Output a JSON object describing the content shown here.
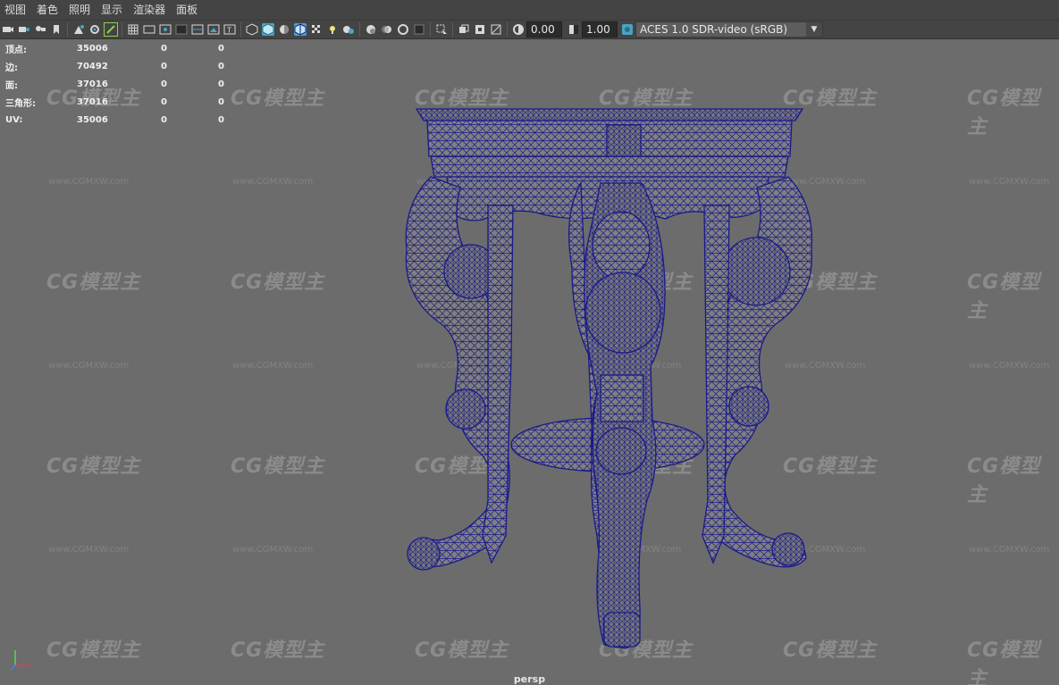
{
  "menu": {
    "items": [
      "视图",
      "着色",
      "照明",
      "显示",
      "渲染器",
      "面板"
    ]
  },
  "toolbar": {
    "exposure_value": "0.00",
    "gamma_value": "1.00",
    "color_space": "ACES 1.0 SDR-video (sRGB)"
  },
  "stats": {
    "rows": [
      {
        "label": "顶点:",
        "v1": "35006",
        "v2": "0",
        "v3": "0"
      },
      {
        "label": "边:",
        "v1": "70492",
        "v2": "0",
        "v3": "0"
      },
      {
        "label": "面:",
        "v1": "37016",
        "v2": "0",
        "v3": "0"
      },
      {
        "label": "三角形:",
        "v1": "37016",
        "v2": "0",
        "v3": "0"
      },
      {
        "label": "UV:",
        "v1": "35006",
        "v2": "0",
        "v3": "0"
      }
    ]
  },
  "viewport": {
    "camera_label": "persp"
  },
  "watermark": {
    "logo": "CG模型主",
    "url": "www.CGMXW.com"
  },
  "colors": {
    "wire": "#1a1a8a",
    "mesh_fill": "#7d7d7d",
    "accent": "#4aa3c4"
  }
}
